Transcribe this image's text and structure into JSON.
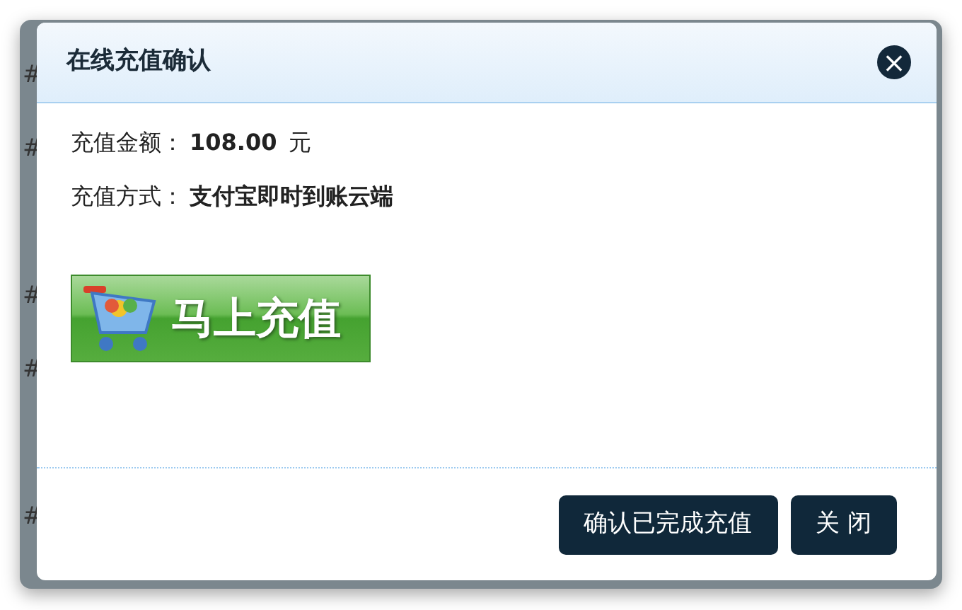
{
  "background_rows": [
    {
      "left": "#"
    },
    {
      "left": "#"
    },
    {},
    {
      "left": "#"
    },
    {
      "left": "#"
    },
    {},
    {
      "left": "#"
    }
  ],
  "dialog": {
    "title": "在线充值确认",
    "close": "×",
    "fields": [
      {
        "label": "充值金额：",
        "value": "108.00",
        "unit": "元"
      },
      {
        "label": "充值方式：",
        "value": "支付宝即时到账云端"
      }
    ],
    "pay_button": "马上充值",
    "buttons": [
      "确认已完成充值",
      "关 闭"
    ]
  }
}
